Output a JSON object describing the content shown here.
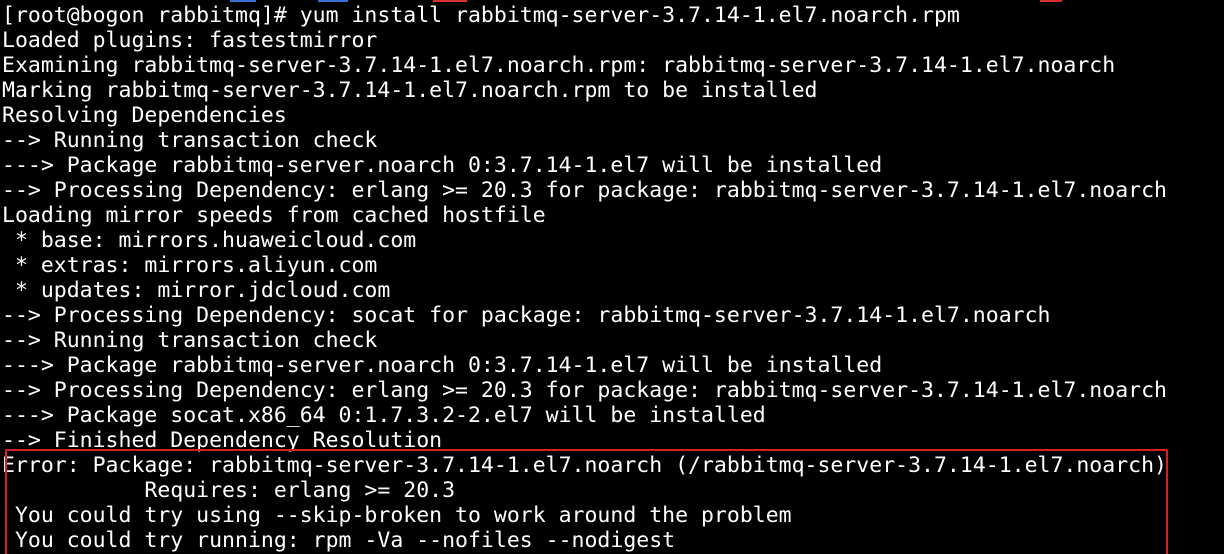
{
  "terminal": {
    "lines": [
      "[root@bogon rabbitmq]# yum install rabbitmq-server-3.7.14-1.el7.noarch.rpm",
      "Loaded plugins: fastestmirror",
      "Examining rabbitmq-server-3.7.14-1.el7.noarch.rpm: rabbitmq-server-3.7.14-1.el7.noarch",
      "Marking rabbitmq-server-3.7.14-1.el7.noarch.rpm to be installed",
      "Resolving Dependencies",
      "--> Running transaction check",
      "---> Package rabbitmq-server.noarch 0:3.7.14-1.el7 will be installed",
      "--> Processing Dependency: erlang >= 20.3 for package: rabbitmq-server-3.7.14-1.el7.noarch",
      "Loading mirror speeds from cached hostfile",
      " * base: mirrors.huaweicloud.com",
      " * extras: mirrors.aliyun.com",
      " * updates: mirror.jdcloud.com",
      "--> Processing Dependency: socat for package: rabbitmq-server-3.7.14-1.el7.noarch",
      "--> Running transaction check",
      "---> Package rabbitmq-server.noarch 0:3.7.14-1.el7 will be installed",
      "--> Processing Dependency: erlang >= 20.3 for package: rabbitmq-server-3.7.14-1.el7.noarch",
      "---> Package socat.x86_64 0:1.7.3.2-2.el7 will be installed",
      "--> Finished Dependency Resolution",
      "Error: Package: rabbitmq-server-3.7.14-1.el7.noarch (/rabbitmq-server-3.7.14-1.el7.noarch)",
      "           Requires: erlang >= 20.3",
      " You could try using --skip-broken to work around the problem",
      " You could try running: rpm -Va --nofiles --nodigest"
    ]
  },
  "colors": {
    "background": "#000000",
    "text": "#ffffff",
    "highlight_border": "#d82020",
    "artifact_blue": "#3a6fd8",
    "artifact_red": "#d83030"
  }
}
